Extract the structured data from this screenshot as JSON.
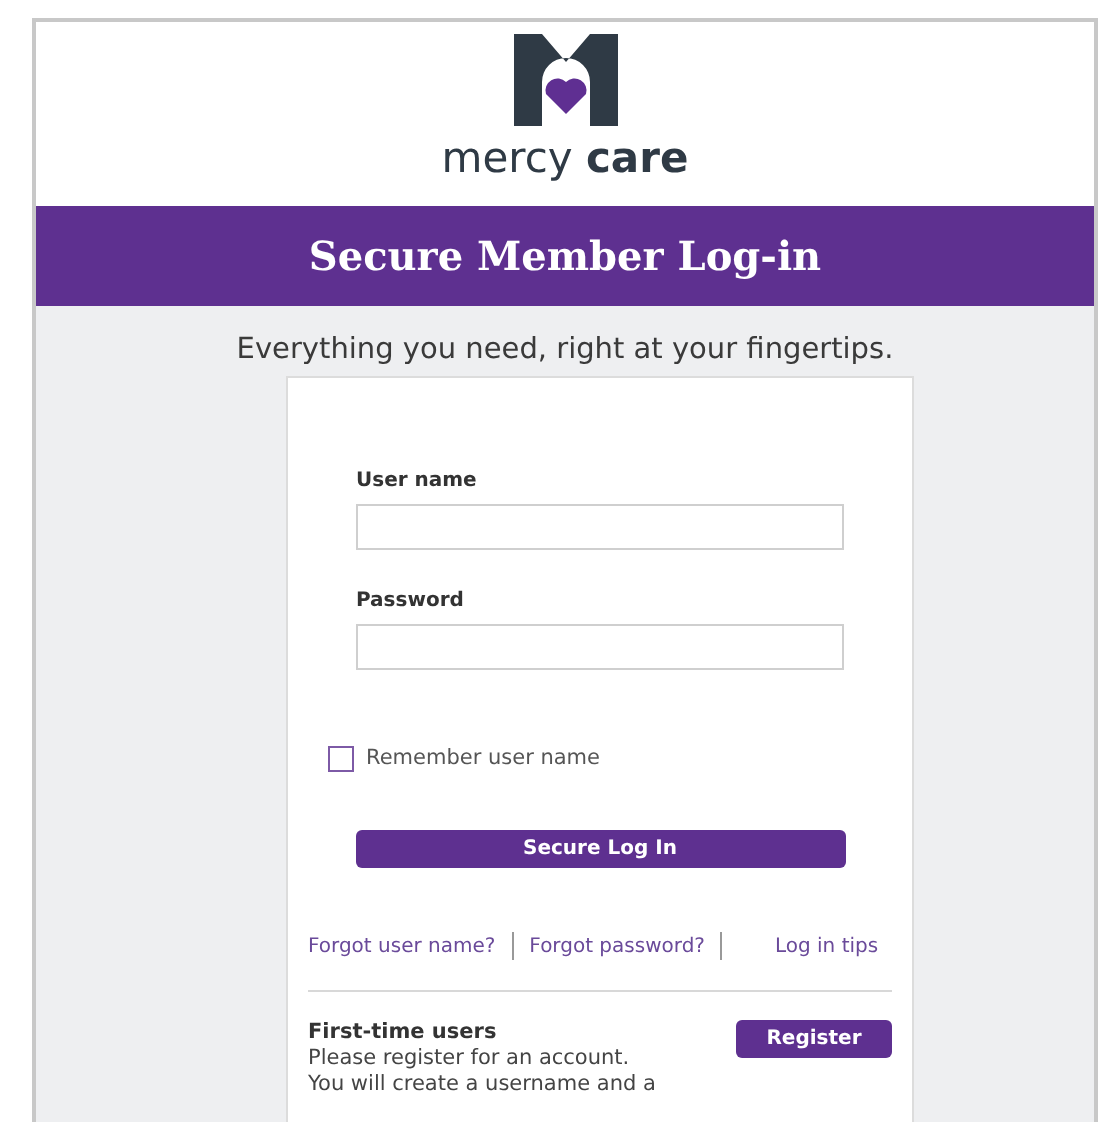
{
  "logo": {
    "wordmark": "mercy **care**"
  },
  "banner": {
    "title": "Secure Member Log-in"
  },
  "tagline": "Everything you need, right at your fingertips.",
  "form": {
    "fields": [
      {
        "label": "User name"
      },
      {
        "label": "Password"
      }
    ],
    "remember": {
      "label": "Remember user name",
      "checked": false
    },
    "submit": "Secure Log In",
    "links": [
      "Forgot user name?",
      "Forgot password?",
      "Log in tips"
    ]
  },
  "first_time": {
    "title": "First-time users",
    "button": "Register",
    "lines": [
      "Please register for an account.",
      "You will create a username and a"
    ]
  }
}
